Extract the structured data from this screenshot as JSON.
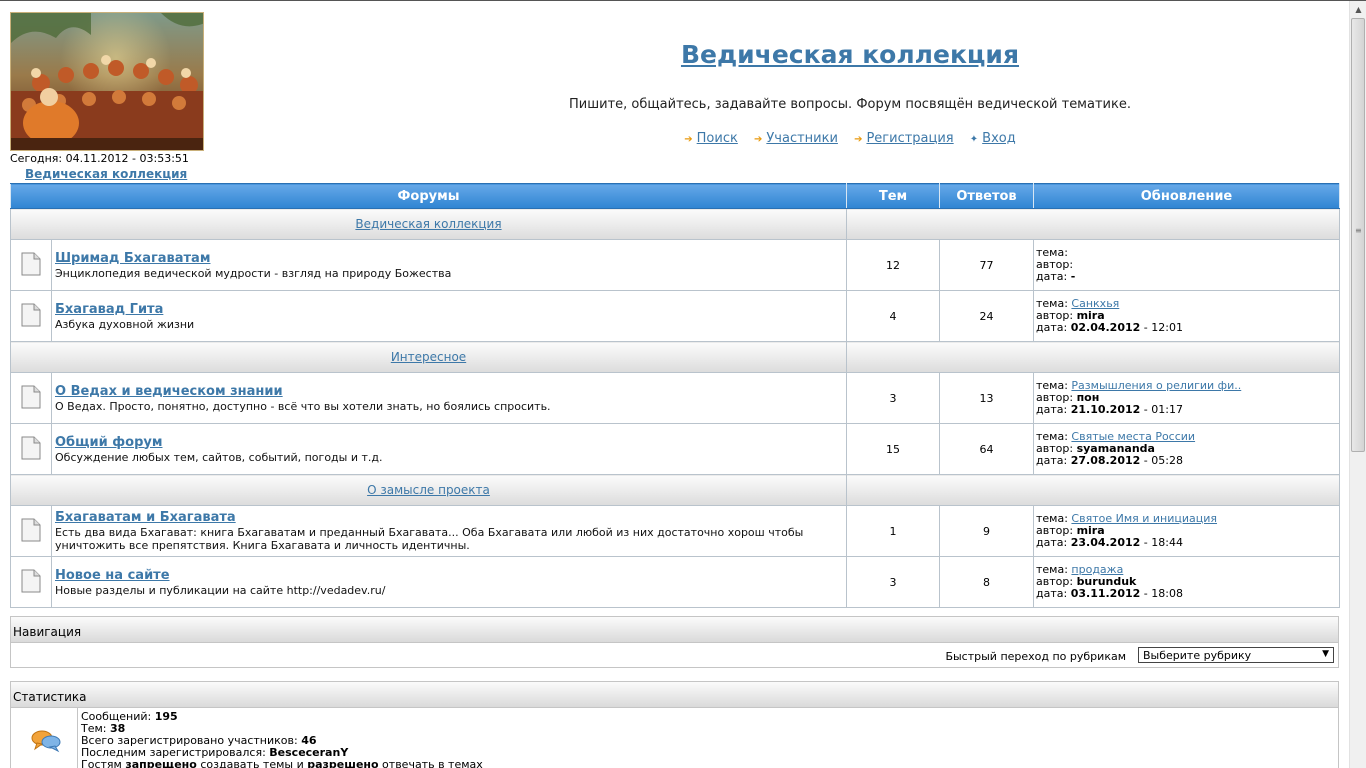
{
  "header": {
    "today": "Сегодня: 04.11.2012 - 03:53:51",
    "breadcrumb": "Ведическая коллекция",
    "title": "Ведическая коллекция",
    "description": "Пишите, общайтесь, задавайте вопросы. Форум посвящён ведической тематике.",
    "nav": [
      {
        "label": "Поиск",
        "icon": "arrow-icon"
      },
      {
        "label": "Участники",
        "icon": "arrow-icon"
      },
      {
        "label": "Регистрация",
        "icon": "arrow-icon"
      },
      {
        "label": "Вход",
        "icon": "login-star-icon"
      }
    ]
  },
  "table": {
    "headers": {
      "forums": "Форумы",
      "topics": "Тем",
      "replies": "Ответов",
      "updated": "Обновление"
    },
    "last_labels": {
      "topic": "тема:",
      "author": "автор:",
      "date": "дата:"
    },
    "categories": [
      {
        "name": "Ведическая коллекция",
        "forums": [
          {
            "name": "Шримад Бхагаватам",
            "desc": "Энциклопедия ведической мудрости - взгляд на природу Божества",
            "topics": "12",
            "replies": "77",
            "last_topic": "",
            "last_author": "",
            "last_date": "-",
            "last_time": ""
          },
          {
            "name": "Бхагавад Гита",
            "desc": "Азбука духовной жизни",
            "topics": "4",
            "replies": "24",
            "last_topic": "Санкхья",
            "last_author": "mira",
            "last_date": "02.04.2012",
            "last_time": " - 12:01"
          }
        ]
      },
      {
        "name": "Интересное",
        "forums": [
          {
            "name": "О Ведах и ведическом знании",
            "desc": "О Ведах. Просто, понятно, доступно - всё что вы хотели знать, но боялись спросить.",
            "topics": "3",
            "replies": "13",
            "last_topic": "Размышления о религии фи..",
            "last_author": "пон",
            "last_date": "21.10.2012",
            "last_time": " - 01:17"
          },
          {
            "name": "Общий форум",
            "desc": "Обсуждение любых тем, сайтов, событий, погоды и т.д.",
            "topics": "15",
            "replies": "64",
            "last_topic": "Святые места России",
            "last_author": "syamananda",
            "last_date": "27.08.2012",
            "last_time": " - 05:28"
          }
        ]
      },
      {
        "name": "О замысле проекта",
        "forums": [
          {
            "name": "Бхагаватам и Бхагавата",
            "desc": "Есть два вида Бхагават: книга Бхагаватам и преданный Бхагавата... Оба Бхагавата или любой из них достаточно хорош чтобы уничтожить все препятствия. Книга Бхагавата и личность идентичны.",
            "topics": "1",
            "replies": "9",
            "last_topic": "Святое Имя и инициация",
            "last_author": "mira",
            "last_date": "23.04.2012",
            "last_time": " - 18:44"
          },
          {
            "name": "Новое на сайте",
            "desc": "Новые разделы и публикации на сайте http://vedadev.ru/",
            "topics": "3",
            "replies": "8",
            "last_topic": "продажа",
            "last_author": "burunduk",
            "last_date": "03.11.2012",
            "last_time": " - 18:08"
          }
        ]
      }
    ]
  },
  "navigation": {
    "title": "Навигация",
    "quick_jump_label": "Быстрый переход по рубрикам",
    "quick_jump_value": "Выберите рубрику"
  },
  "stats": {
    "title": "Статистика",
    "messages_label": "Сообщений: ",
    "messages": "195",
    "topics_label": "Тем: ",
    "topics": "38",
    "members_label": "Всего зарегистрировано участников: ",
    "members": "46",
    "last_member_label": "Последним зарегистрировался: ",
    "last_member": "BescecеranY",
    "guest_prefix": "Гостям ",
    "guest_forbidden": "запрещено",
    "guest_middle": " создавать темы и ",
    "guest_allowed": "разрешено",
    "guest_suffix": " отвечать в темах"
  },
  "colors": {
    "accent": "#3d78a8",
    "header_bar": "#3a8ad6"
  }
}
